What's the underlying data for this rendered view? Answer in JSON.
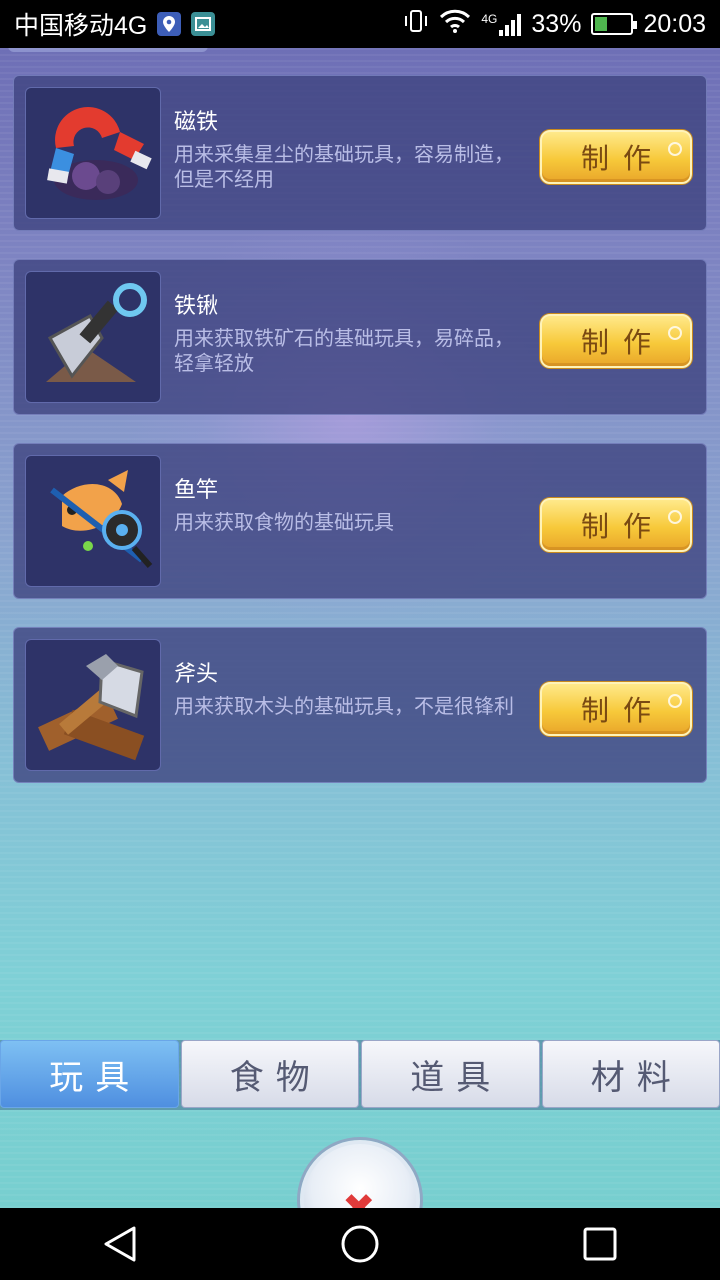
{
  "status_bar": {
    "carrier": "中国移动4G",
    "network_badge": "4G",
    "battery_percent": "33%",
    "battery_level": 0.33,
    "time": "20:03",
    "icons": [
      "location-icon",
      "image-icon",
      "vibrate-icon",
      "wifi-icon",
      "signal-icon",
      "battery-charging-icon"
    ]
  },
  "items": [
    {
      "title": "磁铁",
      "description": "用来采集星尘的基础玩具，容易制造，但是不经用",
      "button": "制作",
      "icon": "magnet-icon"
    },
    {
      "title": "铁锹",
      "description": "用来获取铁矿石的基础玩具，易碎品，轻拿轻放",
      "button": "制作",
      "icon": "shovel-icon"
    },
    {
      "title": "鱼竿",
      "description": "用来获取食物的基础玩具",
      "button": "制作",
      "icon": "fishing-rod-icon"
    },
    {
      "title": "斧头",
      "description": "用来获取木头的基础玩具，不是很锋利",
      "button": "制作",
      "icon": "axe-icon"
    }
  ],
  "tabs": [
    {
      "label": "玩具",
      "active": true
    },
    {
      "label": "食物",
      "active": false
    },
    {
      "label": "道具",
      "active": false
    },
    {
      "label": "材料",
      "active": false
    }
  ],
  "close_button": {
    "icon": "close-icon",
    "symbol": "✖"
  },
  "nav_bar": {
    "icons": [
      "back-icon",
      "home-icon",
      "recents-icon"
    ]
  },
  "colors": {
    "make_button": "#f7c93a",
    "active_tab": "#4f8fe0",
    "card_background": "#3e4380"
  }
}
